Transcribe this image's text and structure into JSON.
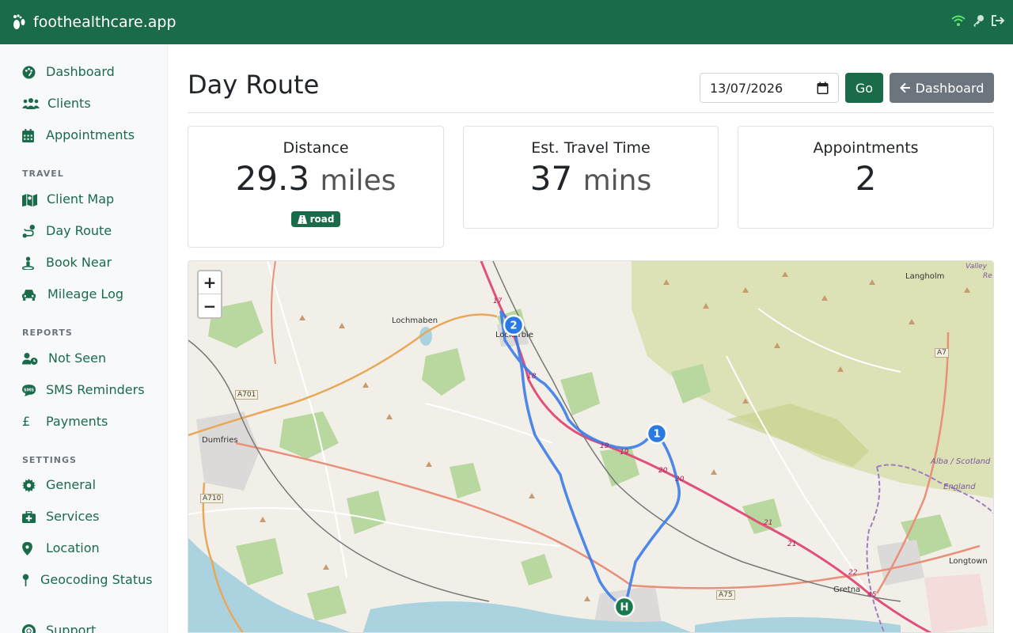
{
  "app": {
    "brand": "foothealthcare.app"
  },
  "sidebar": {
    "items": [
      {
        "label": "Dashboard",
        "icon": "palette-icon"
      },
      {
        "label": "Clients",
        "icon": "users-icon"
      },
      {
        "label": "Appointments",
        "icon": "calendar-icon"
      },
      {
        "label": "Client Map",
        "icon": "map-icon"
      },
      {
        "label": "Day Route",
        "icon": "route-icon"
      },
      {
        "label": "Book Near",
        "icon": "person-pin-icon"
      },
      {
        "label": "Mileage Log",
        "icon": "car-icon"
      },
      {
        "label": "Not Seen",
        "icon": "user-clock-icon"
      },
      {
        "label": "SMS Reminders",
        "icon": "sms-icon"
      },
      {
        "label": "Payments",
        "icon": "pound-icon"
      },
      {
        "label": "General",
        "icon": "gear-icon"
      },
      {
        "label": "Services",
        "icon": "medical-kit-icon"
      },
      {
        "label": "Location",
        "icon": "location-pin-icon"
      },
      {
        "label": "Geocoding Status",
        "icon": "map-pin-icon"
      },
      {
        "label": "Support",
        "icon": "lifebuoy-icon"
      }
    ],
    "headings": {
      "travel": "TRAVEL",
      "reports": "REPORTS",
      "settings": "SETTINGS"
    }
  },
  "page": {
    "title": "Day Route",
    "date_value": "13/07/2026",
    "go_label": "Go",
    "dashboard_label": "Dashboard"
  },
  "stats": {
    "distance": {
      "label": "Distance",
      "value": "29.3",
      "unit": "miles",
      "badge": "road"
    },
    "travel_time": {
      "label": "Est. Travel Time",
      "value": "37",
      "unit": "mins"
    },
    "appointments": {
      "label": "Appointments",
      "value": "2"
    }
  },
  "map": {
    "zoom_in": "+",
    "zoom_out": "−",
    "markers": [
      {
        "label": "1",
        "color": "#2a7ae2"
      },
      {
        "label": "2",
        "color": "#2a7ae2"
      },
      {
        "label": "H",
        "color": "#1a7a4f"
      }
    ],
    "places": [
      "Lochmaben",
      "Lockerbie",
      "Dumfries",
      "Langholm",
      "Longtown",
      "Gretna",
      "Alba / Scotland",
      "England",
      "Valley",
      "Re"
    ],
    "roads": [
      "A701",
      "A710",
      "A7",
      "A75"
    ],
    "route_numbers": [
      "17",
      "18",
      "19",
      "19",
      "20",
      "20",
      "21",
      "21",
      "22",
      "45"
    ]
  },
  "colors": {
    "brand": "#1a6b4a",
    "secondary": "#6c757d",
    "route": "#3b7be8"
  }
}
